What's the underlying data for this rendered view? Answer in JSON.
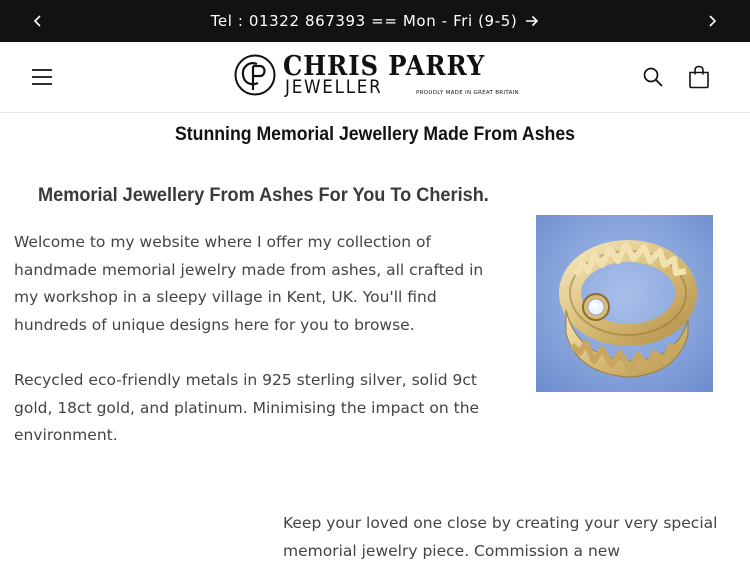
{
  "announcement": {
    "text": "Tel : 01322 867393 == Mon - Fri (9-5)",
    "prev_icon": "chevron-left-icon",
    "next_icon": "chevron-right-icon",
    "link_icon": "arrow-right-icon"
  },
  "header": {
    "logo": {
      "name": "CHRIS PARRY",
      "sub": "JEWELLER",
      "tagline": "PROUDLY MADE IN GREAT BRITAIN"
    },
    "menu_icon": "hamburger-menu-icon",
    "search_icon": "search-icon",
    "cart_icon": "shopping-bag-icon"
  },
  "content": {
    "title": "Stunning Memorial Jewellery Made From Ashes",
    "heading": "Memorial Jewellery From Ashes For You To Cherish.",
    "paragraph1": "Welcome to my website where I offer my collection of handmade memorial jewelry made from ashes, all crafted in my workshop in a sleepy village in Kent, UK. You'll find hundreds of unique designs here for you to browse.",
    "paragraph2": "Recycled eco-friendly metals in 925 sterling silver, solid 9ct gold, 18ct gold, and platinum. Minimising the impact on the environment.",
    "paragraph3": "Keep your loved one close by creating your very special memorial jewelry piece. Commission a new"
  },
  "colors": {
    "announcement_bg": "#121212",
    "image_bg": "#7f9fd8",
    "body_text": "#444444"
  }
}
